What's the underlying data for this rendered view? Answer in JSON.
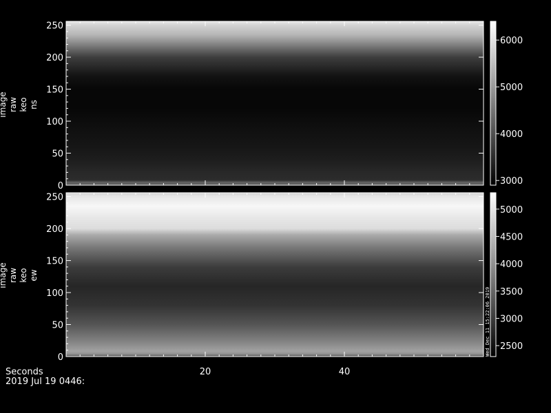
{
  "chart_data": [
    {
      "type": "heatmap",
      "ylabel_lines": [
        "image",
        "raw",
        "keo",
        "ns"
      ],
      "ylim": [
        0,
        256
      ],
      "yticks": [
        0,
        50,
        100,
        150,
        200,
        250
      ],
      "xlim": [
        0,
        60
      ],
      "colorbar": {
        "range": [
          2900,
          6400
        ],
        "ticks": [
          3000,
          4000,
          5000,
          6000
        ]
      },
      "intensity_profile": [
        [
          0,
          4000
        ],
        [
          4,
          4300
        ],
        [
          8,
          3500
        ],
        [
          20,
          3450
        ],
        [
          40,
          3300
        ],
        [
          60,
          3200
        ],
        [
          90,
          3100
        ],
        [
          120,
          3000
        ],
        [
          150,
          3000
        ],
        [
          170,
          3150
        ],
        [
          185,
          3450
        ],
        [
          200,
          3750
        ],
        [
          212,
          4300
        ],
        [
          222,
          4800
        ],
        [
          235,
          5400
        ],
        [
          250,
          5800
        ],
        [
          256,
          6100
        ]
      ],
      "grid": false
    },
    {
      "type": "heatmap",
      "ylabel_lines": [
        "image",
        "raw",
        "keo",
        "ew"
      ],
      "ylim": [
        0,
        256
      ],
      "yticks": [
        0,
        50,
        100,
        150,
        200,
        250
      ],
      "xlim": [
        0,
        60
      ],
      "colorbar": {
        "range": [
          2300,
          5300
        ],
        "ticks": [
          2500,
          3000,
          3500,
          4000,
          4500,
          5000
        ]
      },
      "intensity_profile": [
        [
          0,
          3200
        ],
        [
          4,
          4000
        ],
        [
          8,
          4200
        ],
        [
          25,
          3800
        ],
        [
          50,
          3300
        ],
        [
          80,
          2900
        ],
        [
          110,
          2750
        ],
        [
          140,
          3000
        ],
        [
          170,
          3700
        ],
        [
          190,
          4300
        ],
        [
          200,
          4900
        ],
        [
          215,
          5000
        ],
        [
          235,
          5200
        ],
        [
          250,
          5000
        ],
        [
          256,
          4800
        ]
      ],
      "grid": false
    }
  ],
  "shared_x": {
    "label": "Seconds",
    "ticks": [
      20,
      40
    ]
  },
  "footer": {
    "date": "2019 Jul 19 0446:"
  },
  "side_note": "Wed Dec 11 15:22:06 2019"
}
